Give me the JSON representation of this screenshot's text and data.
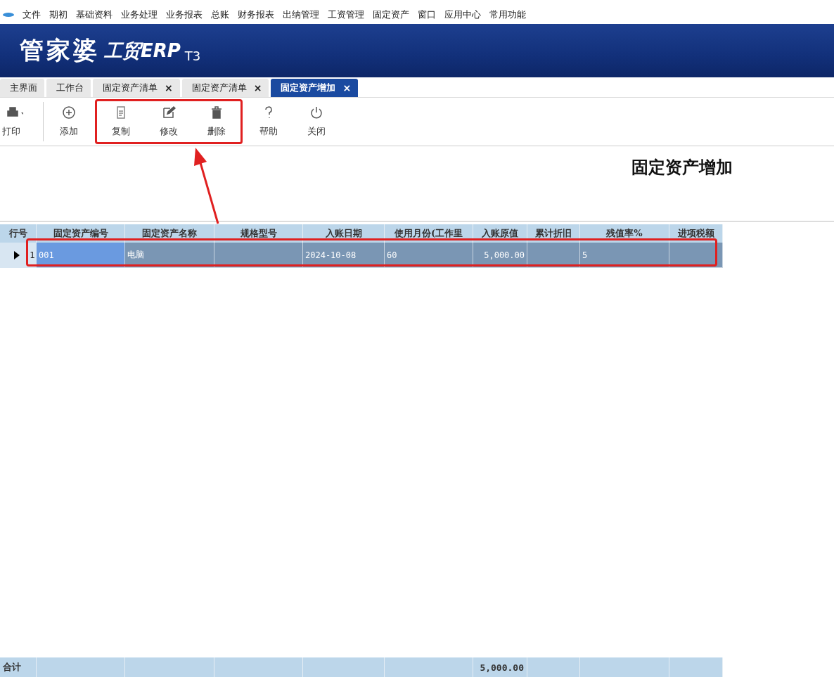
{
  "menu": [
    "文件",
    "期初",
    "基础资料",
    "业务处理",
    "业务报表",
    "总账",
    "财务报表",
    "出纳管理",
    "工资管理",
    "固定资产",
    "窗口",
    "应用中心",
    "常用功能"
  ],
  "banner": {
    "brand": "管家婆",
    "product": "工贸ERP",
    "edition": "T3"
  },
  "tabs": [
    {
      "label": "主界面",
      "selected": false
    },
    {
      "label": "工作台",
      "selected": false
    },
    {
      "label": "固定资产清单",
      "selected": false,
      "close": "×"
    },
    {
      "label": "固定资产清单",
      "selected": false,
      "close": "×"
    },
    {
      "label": "固定资产增加",
      "selected": true,
      "close": "×"
    }
  ],
  "toolbar": [
    {
      "highlighted": false,
      "items": [
        {
          "kind": "print",
          "label": "打印"
        },
        {
          "kind": "add",
          "label": "添加"
        }
      ]
    },
    {
      "highlighted": true,
      "items": [
        {
          "kind": "copy",
          "label": "复制"
        },
        {
          "kind": "edit",
          "label": "修改"
        },
        {
          "kind": "delete",
          "label": "删除"
        }
      ]
    },
    {
      "highlighted": false,
      "items": [
        {
          "kind": "help",
          "label": "帮助"
        },
        {
          "kind": "close",
          "label": "关闭"
        }
      ]
    }
  ],
  "page_title": "固定资产增加",
  "table": {
    "columns": [
      "行号",
      "固定资产编号",
      "固定资产名称",
      "规格型号",
      "入账日期",
      "使用月份(工作里",
      "入账原值",
      "累计折旧",
      "残值率%",
      "进项税额"
    ],
    "rows": [
      {
        "cells": [
          "1",
          "001",
          "电脑",
          "",
          "2024-10-08",
          "60",
          "5,000.00",
          "",
          "5",
          ""
        ],
        "selected": true,
        "highlighted": true
      }
    ],
    "totals": [
      {
        "kind": "label",
        "text": "合计"
      },
      {
        "kind": "blank"
      },
      {
        "kind": "blank"
      },
      {
        "kind": "blank"
      },
      {
        "kind": "blank"
      },
      {
        "kind": "blank"
      },
      {
        "kind": "amount",
        "text": "5,000.00"
      },
      {
        "kind": "blank"
      },
      {
        "kind": "blank"
      },
      {
        "kind": "blank"
      }
    ]
  }
}
